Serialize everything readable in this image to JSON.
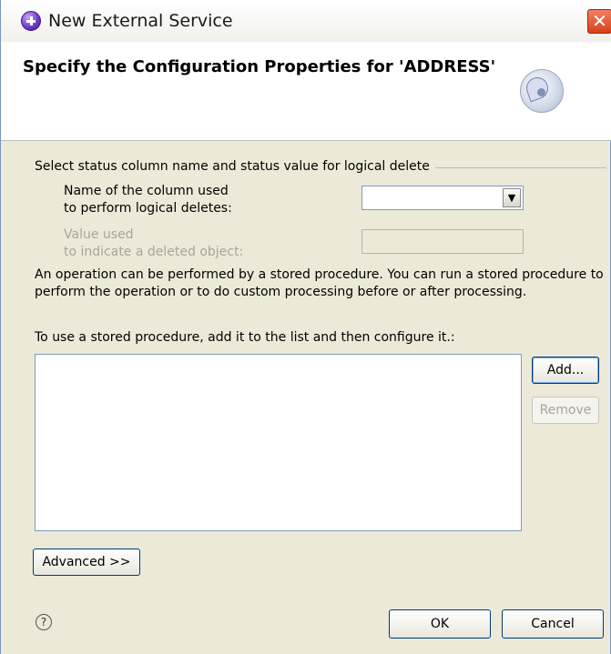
{
  "window": {
    "title": "New External Service",
    "close_symbol": "✕",
    "app_icon": "service-icon"
  },
  "banner": {
    "title": "Specify the Configuration Properties for 'ADDRESS'",
    "icon": "dial-icon"
  },
  "logical_delete": {
    "group_label": "Select status column name and status value for logical delete",
    "column_label": "Name of the column used\nto perform logical deletes:",
    "column_value": "",
    "value_label": "Value used\nto indicate a deleted object:",
    "value_value": ""
  },
  "stored_procedure": {
    "description": "An operation can be performed by a stored procedure. You can run a stored procedure to perform the operation or to do custom processing before or after processing.",
    "list_label": "To use a stored procedure, add it to the list and then configure it.:",
    "items": [],
    "add_label": "Add...",
    "remove_label": "Remove"
  },
  "advanced_label": "Advanced >>",
  "footer": {
    "help_symbol": "?",
    "ok_label": "OK",
    "cancel_label": "Cancel"
  }
}
